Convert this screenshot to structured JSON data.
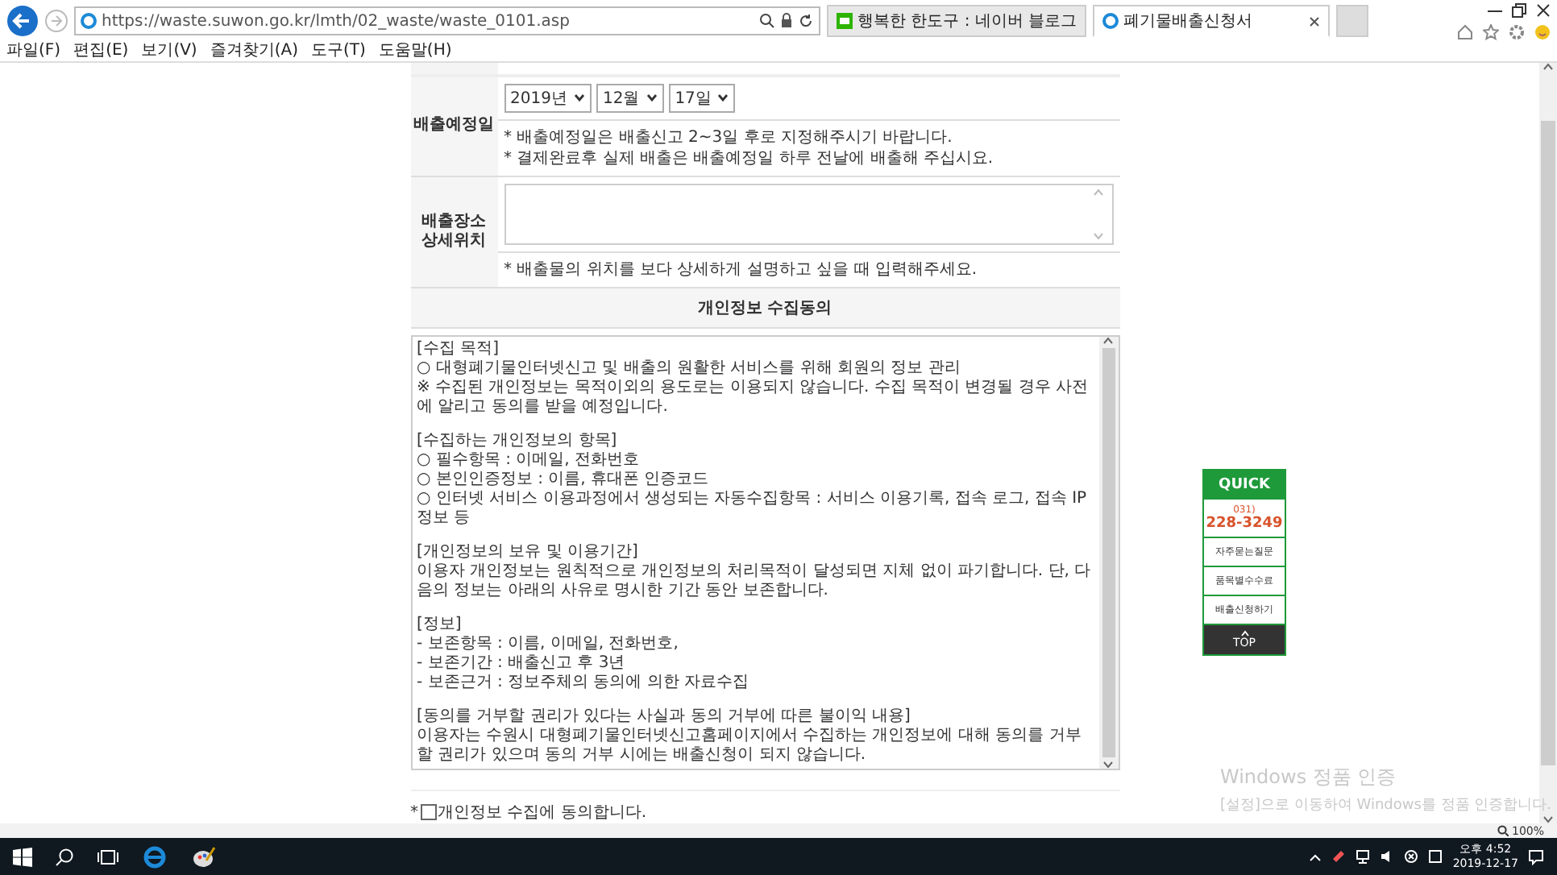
{
  "browser": {
    "address": "https://waste.suwon.go.kr/lmth/02_waste/waste_0101.asp",
    "tabs": [
      {
        "title": "행복한 한도구 : 네이버 블로그",
        "selected": false
      },
      {
        "title": "폐기물배출신청서",
        "selected": true
      }
    ],
    "menu": [
      "파일(F)",
      "편집(E)",
      "보기(V)",
      "즐겨찾기(A)",
      "도구(T)",
      "도움말(H)"
    ],
    "zoom": "100%"
  },
  "form": {
    "rows": [
      {
        "kind": "date",
        "label": [
          "배출예정일"
        ],
        "selects": [
          "2019년",
          "12월",
          "17일"
        ],
        "notes": [
          "* 배출예정일은 배출신고 2~3일 후로 지정해주시기 바랍니다.",
          "* 결제완료후 실제 배출은 배출예정일 하루 전날에 배출해 주십시요."
        ]
      },
      {
        "kind": "textarea",
        "label": [
          "배출장소",
          "상세위치"
        ],
        "notes": [
          "* 배출물의 위치를 보다 상세하게 설명하고 싶을 때 입력해주세요."
        ]
      }
    ],
    "consent_header": "개인정보 수집동의",
    "consent_sections": [
      {
        "heading": "[수집 목적]",
        "lines": [
          "○ 대형폐기물인터넷신고 및 배출의 원활한 서비스를 위해 회원의 정보 관리",
          "※ 수집된 개인정보는 목적이외의 용도로는 이용되지 않습니다. 수집 목적이 변경될 경우 사전에 알리고 동의를 받을 예정입니다."
        ]
      },
      {
        "heading": "[수집하는 개인정보의 항목]",
        "lines": [
          "○ 필수항목 : 이메일, 전화번호",
          "○ 본인인증정보 : 이름, 휴대폰 인증코드",
          "○ 인터넷 서비스 이용과정에서 생성되는 자동수집항목 : 서비스 이용기록, 접속 로그, 접속 IP 정보 등"
        ]
      },
      {
        "heading": "[개인정보의 보유 및 이용기간]",
        "lines": [
          "이용자 개인정보는 원칙적으로 개인정보의 처리목적이 달성되면 지체 없이 파기합니다. 단, 다음의 정보는 아래의 사유로 명시한 기간 동안 보존합니다."
        ]
      },
      {
        "heading": "[정보]",
        "lines": [
          "- 보존항목 : 이름, 이메일, 전화번호,",
          "- 보존기간 : 배출신고 후 3년",
          "- 보존근거 : 정보주체의 동의에 의한 자료수집"
        ]
      },
      {
        "heading": "[동의를 거부할 권리가 있다는 사실과 동의 거부에 따른 불이익 내용]",
        "lines": [
          "이용자는 수원시 대형폐기물인터넷신고홈페이지에서 수집하는 개인정보에 대해 동의를 거부할 권리가 있으며 동의 거부 시에는 배출신청이 되지 않습니다."
        ]
      }
    ],
    "agree": {
      "prefix": "*",
      "label": "개인정보 수집에 동의합니다.",
      "checked": false
    }
  },
  "quick": {
    "title": "QUICK",
    "phone_area": "031)",
    "phone": "228-3249",
    "links": [
      "자주묻는질문",
      "품목별수수료",
      "배출신청하기"
    ],
    "top": "TOP"
  },
  "activation": {
    "title": "Windows 정품 인증",
    "message": "[설정]으로 이동하여 Windows를 정품 인증합니다."
  },
  "taskbar": {
    "time": "오후 4:52",
    "date": "2019-12-17"
  }
}
